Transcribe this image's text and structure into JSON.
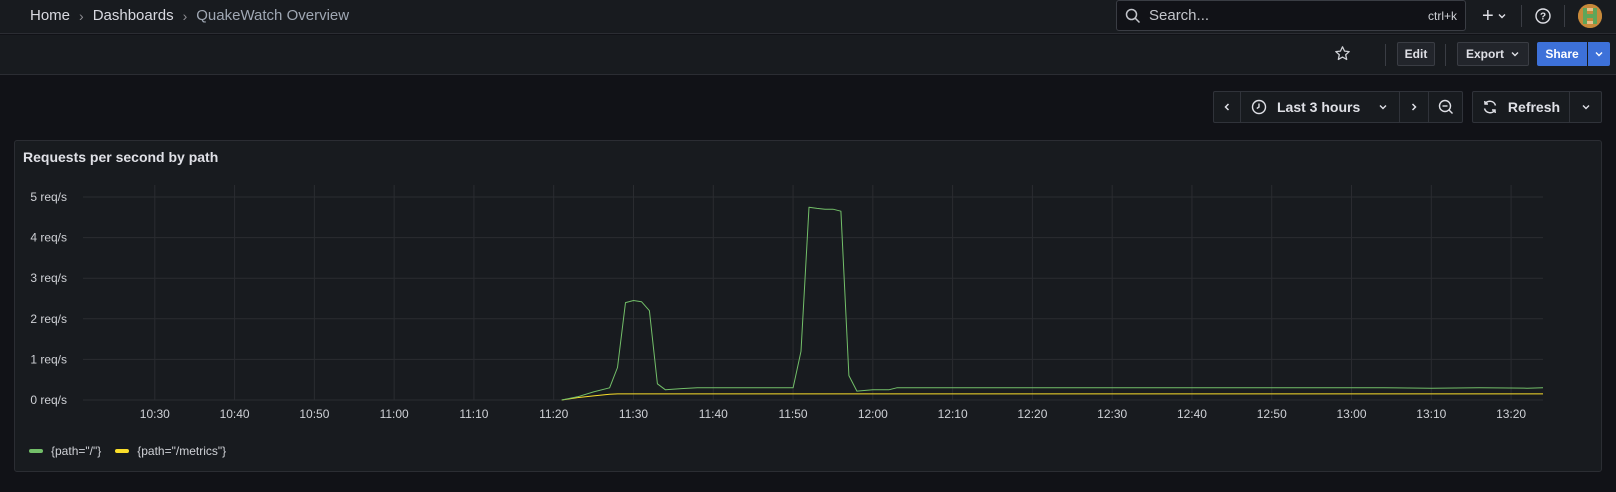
{
  "breadcrumb": {
    "home": "Home",
    "dashboards": "Dashboards",
    "current": "QuakeWatch Overview"
  },
  "search": {
    "placeholder": "Search...",
    "shortcut": "ctrl+k"
  },
  "toolbar": {
    "edit_label": "Edit",
    "export_label": "Export",
    "share_label": "Share"
  },
  "timepicker": {
    "range_label": "Last 3 hours",
    "refresh_label": "Refresh"
  },
  "panel": {
    "title": "Requests per second by path"
  },
  "colors": {
    "series_root": "#73bf69",
    "series_metrics": "#fade2a",
    "share": "#3d71d9"
  },
  "chart_data": {
    "type": "line",
    "title": "Requests per second by path",
    "y_unit": "req/s",
    "ylim": [
      0,
      5
    ],
    "y_ticks": [
      "0 req/s",
      "1 req/s",
      "2 req/s",
      "3 req/s",
      "4 req/s",
      "5 req/s"
    ],
    "x_ticks": [
      "10:30",
      "10:40",
      "10:50",
      "11:00",
      "11:10",
      "11:20",
      "11:30",
      "11:40",
      "11:50",
      "12:00",
      "12:10",
      "12:20",
      "12:30",
      "12:40",
      "12:50",
      "13:00",
      "13:10",
      "13:20"
    ],
    "xlim": [
      "10:21",
      "13:24"
    ],
    "grid": true,
    "legend_placement": "bottom-left",
    "series": [
      {
        "name": "{path=\"/\"}",
        "color": "#73bf69",
        "points": [
          [
            "11:21",
            0.0
          ],
          [
            "11:23",
            0.08
          ],
          [
            "11:25",
            0.2
          ],
          [
            "11:27",
            0.3
          ],
          [
            "11:28",
            0.8
          ],
          [
            "11:29",
            2.4
          ],
          [
            "11:30",
            2.45
          ],
          [
            "11:31",
            2.42
          ],
          [
            "11:32",
            2.2
          ],
          [
            "11:33",
            0.4
          ],
          [
            "11:34",
            0.25
          ],
          [
            "11:36",
            0.28
          ],
          [
            "11:38",
            0.3
          ],
          [
            "11:50",
            0.3
          ],
          [
            "11:51",
            1.2
          ],
          [
            "11:52",
            4.75
          ],
          [
            "11:53",
            4.72
          ],
          [
            "11:54",
            4.7
          ],
          [
            "11:55",
            4.7
          ],
          [
            "11:56",
            4.65
          ],
          [
            "11:57",
            0.6
          ],
          [
            "11:58",
            0.22
          ],
          [
            "12:00",
            0.25
          ],
          [
            "12:02",
            0.25
          ],
          [
            "12:03",
            0.3
          ],
          [
            "13:04",
            0.3
          ],
          [
            "13:10",
            0.29
          ],
          [
            "13:16",
            0.3
          ],
          [
            "13:22",
            0.29
          ],
          [
            "13:24",
            0.3
          ]
        ]
      },
      {
        "name": "{path=\"/metrics\"}",
        "color": "#fade2a",
        "points": [
          [
            "11:21",
            0.0
          ],
          [
            "11:23",
            0.06
          ],
          [
            "11:25",
            0.1
          ],
          [
            "11:27",
            0.14
          ],
          [
            "11:28",
            0.15
          ],
          [
            "12:03",
            0.15
          ],
          [
            "13:24",
            0.15
          ]
        ]
      }
    ]
  }
}
